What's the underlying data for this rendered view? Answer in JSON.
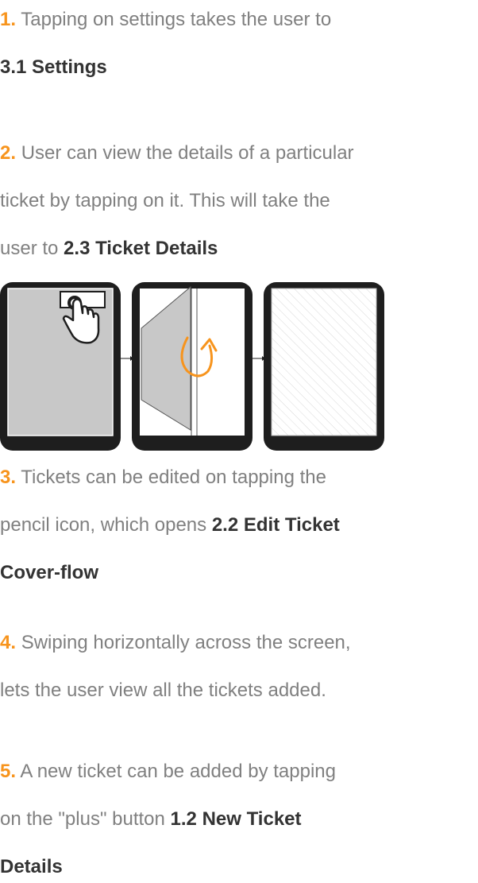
{
  "colors": {
    "number": "#f7941d",
    "body_text": "#808080",
    "highlight_text": "#333333",
    "phone_frame": "#1e1e1e",
    "screen_gray": "#c8c8c8",
    "arrow_orange": "#f7941d"
  },
  "items": [
    {
      "number": "1.",
      "lines": [
        "Tapping on settings takes the user to"
      ],
      "link": "3.1 Settings",
      "link_on_new_line": true
    },
    {
      "number": "2.",
      "lines": [
        "User can view the details of a particular",
        "ticket by tapping on it. This will take the"
      ],
      "tail_text": "user to ",
      "link": "2.3 Ticket Details"
    },
    {
      "number": "3.",
      "lines": [
        "Tickets can be edited on tapping the"
      ],
      "tail_text": "pencil icon, which opens ",
      "link": "2.2 Edit Ticket",
      "link_continuation": "Cover-flow"
    },
    {
      "number": "4.",
      "lines": [
        "Swiping horizontally across the screen,",
        "lets the user view all the tickets added."
      ]
    },
    {
      "number": "5.",
      "lines": [
        "A new ticket can be added by tapping"
      ],
      "tail_text": "on the \"plus\" button ",
      "link": "1.2 New Ticket",
      "link_continuation": "Details"
    }
  ],
  "diagram": {
    "icons": [
      "phone-tap-icon",
      "hand-pointer-icon",
      "page-flip-icon",
      "rotate-arrow-icon",
      "phone-blank-icon"
    ]
  }
}
